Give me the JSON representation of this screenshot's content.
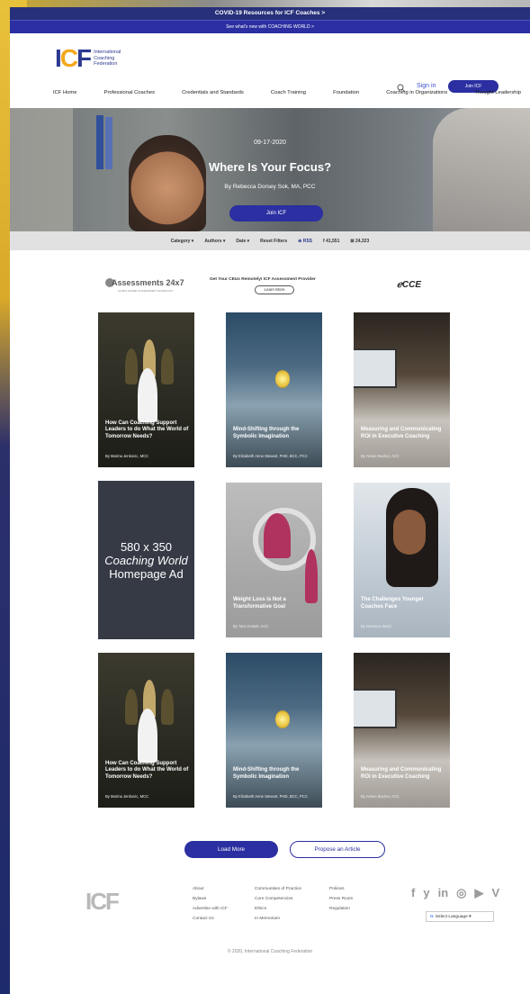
{
  "banners": {
    "top": "COVID-19 Resources for ICF Coaches >",
    "second": "See what's new with COACHING WORLD >"
  },
  "header": {
    "logo_mark": "ICF",
    "logo_line1": "International",
    "logo_line2": "Coaching",
    "logo_line3": "Federation",
    "signin": "Sign in",
    "join": "Join ICF"
  },
  "nav": [
    "ICF Home",
    "Professional Coaches",
    "Credentials and Standards",
    "Coach Training",
    "Foundation",
    "Coaching in Organizations",
    "Thought Leadership"
  ],
  "hero": {
    "date": "09-17-2020",
    "title": "Where Is Your Focus?",
    "author": "By Rebecca Dorsey Sok, MA, PCC",
    "button": "Join ICF"
  },
  "filters": {
    "category": "Category ▾",
    "authors": "Authors ▾",
    "date": "Date ▾",
    "reset": "Reset Filters",
    "rss": "⊕ RSS",
    "fb": "f 41,551",
    "tw": "⊠ 24,323"
  },
  "ads": {
    "assessments": "Assessments 24x7",
    "assessments_sub": "GLOBAL LEADER IN ASSESSMENT TECHNOLOGY",
    "ceu": "Get Your CEUs Remotely! ICF Assessment Provider",
    "learn": "Learn More",
    "cce": "CCE"
  },
  "cards": [
    {
      "title": "How Can Coaching Support Leaders to do What the World of Tomorrow Needs?",
      "author": "By Marina Jenkovic, MCC"
    },
    {
      "title": "Mind-Shifting through the Symbolic Imagination",
      "author": "By Elizabeth Anne Stewart, PHD, BCC, PCC"
    },
    {
      "title": "Measuring and Communicating ROI in Executive Coaching",
      "author": "By Aimee Bucher, ACC"
    },
    {
      "title": "580 x 350 Coaching World Homepage Ad",
      "author": ""
    },
    {
      "title": "Weight Loss is Not a Transformative Goal",
      "author": "By Tara Gosset, ACC"
    },
    {
      "title": "The Challenges Younger Coaches Face",
      "author": "By Nesonca Ward"
    },
    {
      "title": "How Can Coaching Support Leaders to do What the World of Tomorrow Needs?",
      "author": "By Marina Jenkovic, MCC"
    },
    {
      "title": "Mind-Shifting through the Symbolic Imagination",
      "author": "By Elizabeth Anne Stewart, PHD, BCC, PCC"
    },
    {
      "title": "Measuring and Communicating ROI in Executive Coaching",
      "author": "By Aimee Bucher, ACC"
    }
  ],
  "ad_card": {
    "line1": "580 x 350",
    "line2": "Coaching World",
    "line3": "Homepage Ad"
  },
  "buttons": {
    "load_more": "Load More",
    "propose": "Propose an Article"
  },
  "footer": {
    "logo": "ICF",
    "col1": [
      "About",
      "Bylaws",
      "Advertise with ICF",
      "Contact Us"
    ],
    "col2": [
      "Communities of Practice",
      "Core Competencies",
      "Ethics",
      "In Memoriam"
    ],
    "col3": [
      "Policies",
      "Press Room",
      "Regulation"
    ],
    "social": [
      "f",
      "y",
      "in",
      "◎",
      "▶",
      "V"
    ],
    "language": "Select Language ▾",
    "copyright": "© 2020, International Coaching Federation"
  },
  "colors": {
    "primary": "#2b2fa1",
    "banner": "#27307a",
    "accent": "#f2a71b"
  }
}
